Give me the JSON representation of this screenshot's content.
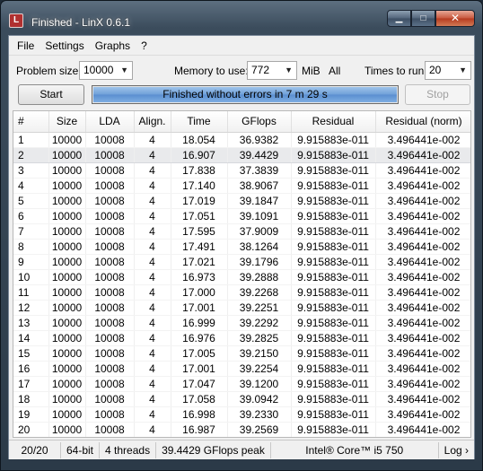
{
  "window": {
    "title": "Finished - LinX 0.6.1",
    "icon": "linx-app-icon",
    "buttons": {
      "minimize": "▁",
      "maximize": "□",
      "close": "✕"
    }
  },
  "menu": [
    "File",
    "Settings",
    "Graphs",
    "?"
  ],
  "options": {
    "problem_size_label": "Problem size:",
    "problem_size_value": "10000",
    "memory_label": "Memory to use:",
    "memory_value": "772",
    "memory_unit": "MiB",
    "all_label": "All",
    "times_label": "Times to run:",
    "times_value": "20"
  },
  "controls": {
    "start_label": "Start",
    "stop_label": "Stop",
    "progress_text": "Finished without errors in 7 m 29 s",
    "progress_percent": 100
  },
  "table": {
    "columns": [
      "#",
      "Size",
      "LDA",
      "Align.",
      "Time",
      "GFlops",
      "Residual",
      "Residual (norm)"
    ],
    "selected_row": 1,
    "rows": [
      [
        "1",
        "10000",
        "10008",
        "4",
        "18.054",
        "36.9382",
        "9.915883e-011",
        "3.496441e-002"
      ],
      [
        "2",
        "10000",
        "10008",
        "4",
        "16.907",
        "39.4429",
        "9.915883e-011",
        "3.496441e-002"
      ],
      [
        "3",
        "10000",
        "10008",
        "4",
        "17.838",
        "37.3839",
        "9.915883e-011",
        "3.496441e-002"
      ],
      [
        "4",
        "10000",
        "10008",
        "4",
        "17.140",
        "38.9067",
        "9.915883e-011",
        "3.496441e-002"
      ],
      [
        "5",
        "10000",
        "10008",
        "4",
        "17.019",
        "39.1847",
        "9.915883e-011",
        "3.496441e-002"
      ],
      [
        "6",
        "10000",
        "10008",
        "4",
        "17.051",
        "39.1091",
        "9.915883e-011",
        "3.496441e-002"
      ],
      [
        "7",
        "10000",
        "10008",
        "4",
        "17.595",
        "37.9009",
        "9.915883e-011",
        "3.496441e-002"
      ],
      [
        "8",
        "10000",
        "10008",
        "4",
        "17.491",
        "38.1264",
        "9.915883e-011",
        "3.496441e-002"
      ],
      [
        "9",
        "10000",
        "10008",
        "4",
        "17.021",
        "39.1796",
        "9.915883e-011",
        "3.496441e-002"
      ],
      [
        "10",
        "10000",
        "10008",
        "4",
        "16.973",
        "39.2888",
        "9.915883e-011",
        "3.496441e-002"
      ],
      [
        "11",
        "10000",
        "10008",
        "4",
        "17.000",
        "39.2268",
        "9.915883e-011",
        "3.496441e-002"
      ],
      [
        "12",
        "10000",
        "10008",
        "4",
        "17.001",
        "39.2251",
        "9.915883e-011",
        "3.496441e-002"
      ],
      [
        "13",
        "10000",
        "10008",
        "4",
        "16.999",
        "39.2292",
        "9.915883e-011",
        "3.496441e-002"
      ],
      [
        "14",
        "10000",
        "10008",
        "4",
        "16.976",
        "39.2825",
        "9.915883e-011",
        "3.496441e-002"
      ],
      [
        "15",
        "10000",
        "10008",
        "4",
        "17.005",
        "39.2150",
        "9.915883e-011",
        "3.496441e-002"
      ],
      [
        "16",
        "10000",
        "10008",
        "4",
        "17.001",
        "39.2254",
        "9.915883e-011",
        "3.496441e-002"
      ],
      [
        "17",
        "10000",
        "10008",
        "4",
        "17.047",
        "39.1200",
        "9.915883e-011",
        "3.496441e-002"
      ],
      [
        "18",
        "10000",
        "10008",
        "4",
        "17.058",
        "39.0942",
        "9.915883e-011",
        "3.496441e-002"
      ],
      [
        "19",
        "10000",
        "10008",
        "4",
        "16.998",
        "39.2330",
        "9.915883e-011",
        "3.496441e-002"
      ],
      [
        "20",
        "10000",
        "10008",
        "4",
        "16.987",
        "39.2569",
        "9.915883e-011",
        "3.496441e-002"
      ]
    ]
  },
  "status": {
    "progress": "20/20",
    "arch": "64-bit",
    "threads": "4 threads",
    "peak": "39.4429 GFlops peak",
    "cpu": "Intel® Core™ i5 750",
    "log": "Log ›"
  }
}
